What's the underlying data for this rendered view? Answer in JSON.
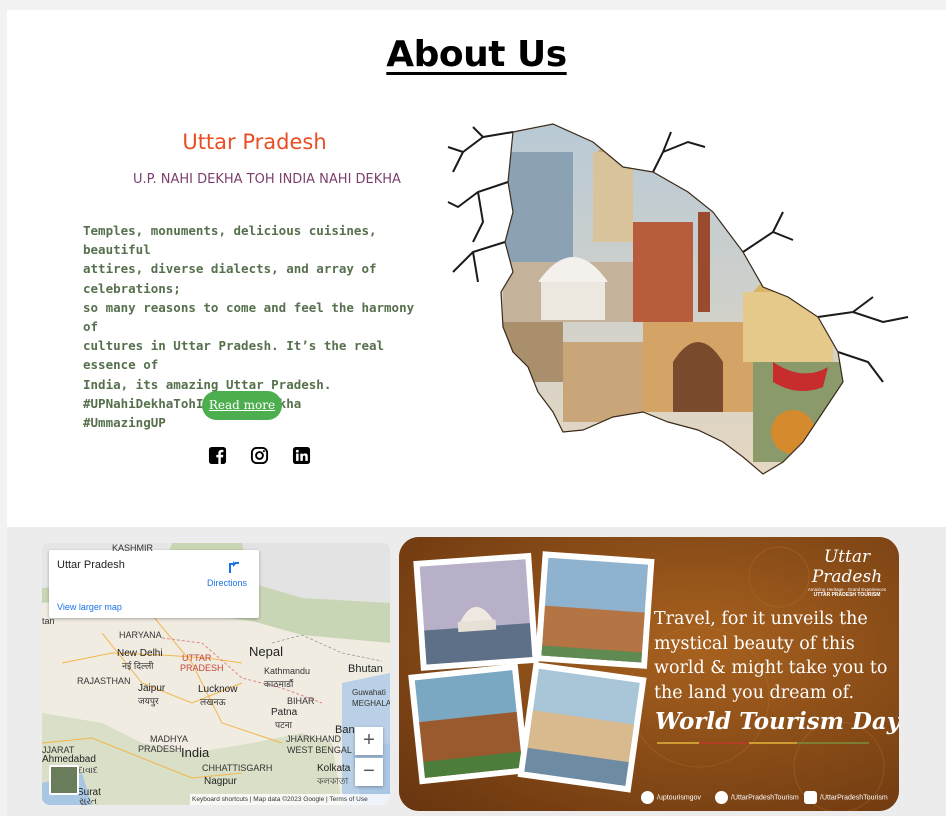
{
  "about": {
    "title": "About Us",
    "state_name": "Uttar Pradesh",
    "tagline": "U.P. NAHI DEKHA TOH INDIA NAHI DEKHA",
    "description_lines": [
      "Temples, monuments, delicious cuisines, beautiful",
      "attires, diverse dialects, and array of celebrations;",
      "so many reasons to come and feel the harmony of",
      "cultures in Uttar Pradesh. It’s the real essence of",
      "India, its amazing Uttar Pradesh.",
      "#UPNahiDekhaTohIndiaNahiDekha",
      "#UmmazingUP"
    ],
    "read_more_label": "Read more",
    "social_icons": [
      "facebook-icon",
      "instagram-icon",
      "linkedin-icon"
    ],
    "accent_color": "#4cae4f",
    "title_color": "#e94e24"
  },
  "map": {
    "place": "Uttar Pradesh",
    "directions": "Directions",
    "view_larger": "View larger map",
    "labels": {
      "kashmir": "KASHMIR",
      "haryana": "HARYANA",
      "new_delhi": "New Delhi",
      "new_delhi_hi": "नई दिल्ली",
      "uttar": "UTTAR",
      "pradesh": "PRADESH",
      "nepal": "Nepal",
      "kathmandu": "Kathmandu",
      "kathmandu_ne": "काठमाडौं",
      "bhutan": "Bhutan",
      "rajasthan": "RAJASTHAN",
      "jaipur": "Jaipur",
      "jaipur_hi": "जयपुर",
      "lucknow": "Lucknow",
      "lucknow_hi": "लखनऊ",
      "bihar": "BIHAR",
      "guwahati": "Guwahati",
      "meghalaya": "MEGHALAY",
      "patna": "Patna",
      "patna_hi": "पटना",
      "jharkhand": "JHARKHAND",
      "madhya": "MADHYA",
      "pradesh2": "PRADESH",
      "bangladesh_short": "Ban",
      "india": "India",
      "west_bengal": "WEST BENGAL",
      "gujarat": "JJARAT",
      "ahmedabad": "Ahmedabad",
      "ahmedabad_gu": "અમદાવાદ",
      "chhattisgarh": "CHHATTISGARH",
      "kolkata": "Kolkata",
      "kolkata_bn": "কলকাতা",
      "nagpur": "Nagpur",
      "surat": "Surat",
      "surat_gu": "સુરત",
      "tan": "tan"
    },
    "attribution": "Keyboard shortcuts  |  Map data ©2023 Google  |  Terms of Use",
    "zoom_in": "+",
    "zoom_out": "−"
  },
  "poster": {
    "brand_script": "Uttar Pradesh",
    "brand_small": "Amazing Heritage · Grand Experiences",
    "brand_strong": "UTTAR PRADESH TOURISM",
    "text_lines": [
      "Travel, for it unveils the",
      "mystical beauty of this",
      "world & might take you to",
      "the land you dream of."
    ],
    "day": "World Tourism Day.",
    "footer": [
      "/uptourismgov",
      "/UttarPradeshTourism",
      "/UttarPradeshTourism"
    ]
  }
}
